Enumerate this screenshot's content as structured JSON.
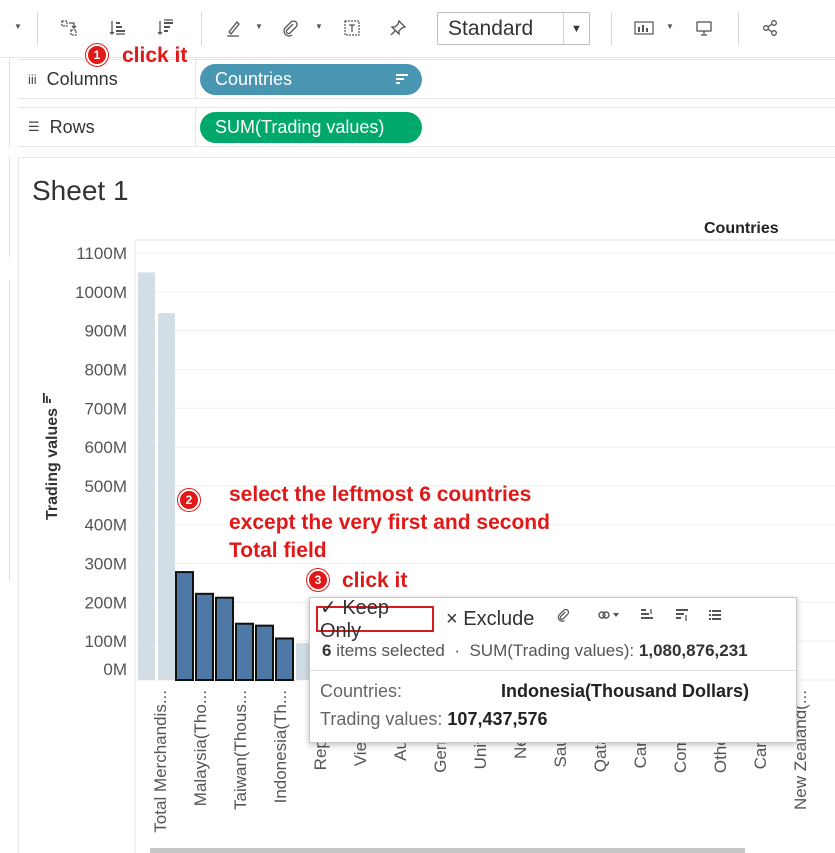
{
  "toolbar": {
    "fit_value": "Standard",
    "icons": [
      "swap-icon",
      "sort-ascending-icon",
      "sort-descending-icon",
      "highlight-icon",
      "attach-icon",
      "text-icon",
      "pin-icon",
      "show-me-icon",
      "presentation-icon",
      "share-icon"
    ]
  },
  "shelves": {
    "columns_label": "Columns",
    "columns_pill": "Countries",
    "rows_label": "Rows",
    "rows_pill": "SUM(Trading values)"
  },
  "sheet": {
    "title": "Sheet 1",
    "column_header": "Countries"
  },
  "chart_data": {
    "type": "bar",
    "xlabel": "",
    "ylabel": "Trading values",
    "ylim": [
      0,
      1100
    ],
    "y_unit": "M",
    "yticks": [
      "0M",
      "100M",
      "200M",
      "300M",
      "400M",
      "500M",
      "600M",
      "700M",
      "800M",
      "900M",
      "1000M",
      "1100M"
    ],
    "categories": [
      "Total Merchandis...",
      "",
      "Malaysia(Tho...",
      "",
      "Taiwan(Thous...",
      "Indonesia(Th...",
      "Republic...",
      "Vietnam...",
      "Australi...",
      "Germany...",
      "United K...",
      "Netherl...",
      "Saudi Ar...",
      "Qatar(Th...",
      "Cambod...",
      "Common...",
      "Other Co...",
      "Canada(...",
      "New Zealand(..."
    ],
    "values": [
      1050,
      945,
      278,
      222,
      212,
      145,
      140,
      107,
      95,
      0,
      0,
      0,
      0,
      0,
      0,
      0,
      0,
      0,
      0
    ],
    "selected": [
      false,
      false,
      true,
      true,
      true,
      true,
      true,
      true,
      false,
      false,
      false,
      false,
      false,
      false,
      false,
      false,
      false,
      false,
      false
    ],
    "selected_color": "#4e79a7",
    "unselected_color": "#d3dde6"
  },
  "tooltip": {
    "keep_only": "✓ Keep Only",
    "exclude": "× Exclude",
    "items_count": "6",
    "items_text": "items selected",
    "sum_label": "SUM(Trading values):",
    "sum_value": "1,080,876,231",
    "countries_label": "Countries:",
    "countries_value": "Indonesia(Thousand Dollars)",
    "values_label": "Trading values:",
    "values_value": "107,437,576"
  },
  "annotations": {
    "step1_num": "1",
    "step1_text": "click it",
    "step2_num": "2",
    "step2_line1": "select the leftmost 6 countries",
    "step2_line2": "except the very first and second",
    "step2_line3": "Total field",
    "step3_num": "3",
    "step3_text": "click it"
  }
}
